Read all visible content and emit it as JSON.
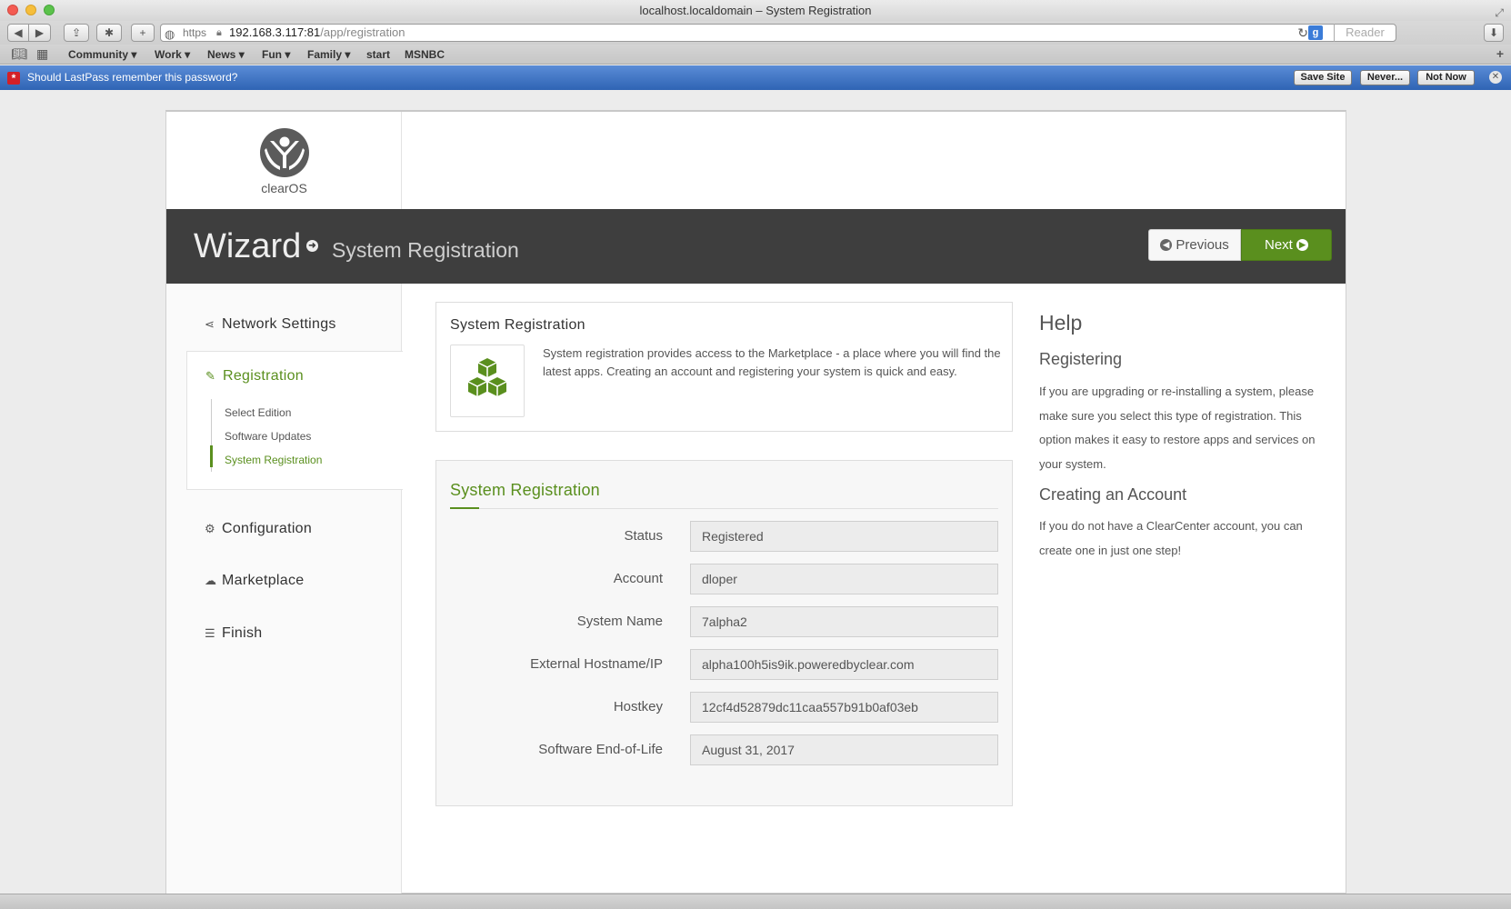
{
  "browser": {
    "title": "localhost.localdomain – System Registration",
    "url_scheme": "https",
    "url_host": "192.168.3.117:81",
    "url_path": "/app/registration",
    "reader_label": "Reader",
    "search_engine_label": "g",
    "bookmarks": [
      "Community",
      "Work",
      "News",
      "Fun",
      "Family",
      "start",
      "MSNBC"
    ]
  },
  "lastpass": {
    "message": "Should LastPass remember this password?",
    "save_site": "Save Site",
    "never": "Never...",
    "not_now": "Not Now"
  },
  "app": {
    "logo_text": "clearOS",
    "wizard_title": "Wizard",
    "wizard_subtitle": "System Registration",
    "previous_label": "Previous",
    "next_label": "Next",
    "accent_color": "#5a8f1e"
  },
  "sidebar": {
    "items": [
      {
        "label": "Network Settings",
        "icon": "share-icon"
      },
      {
        "label": "Registration",
        "icon": "pencil-icon"
      },
      {
        "label": "Configuration",
        "icon": "gears-icon"
      },
      {
        "label": "Marketplace",
        "icon": "cloud-download-icon"
      },
      {
        "label": "Finish",
        "icon": "list-icon"
      }
    ],
    "sub_items": [
      "Select Edition",
      "Software Updates",
      "System Registration"
    ]
  },
  "intro": {
    "title": "System Registration",
    "text": "System registration provides access to the Marketplace - a place where you will find the latest apps. Creating an account and registering your system is quick and easy.",
    "icon": "cubes-icon"
  },
  "form": {
    "title": "System Registration",
    "fields": [
      {
        "label": "Status",
        "value": "Registered"
      },
      {
        "label": "Account",
        "value": "dloper"
      },
      {
        "label": "System Name",
        "value": "7alpha2"
      },
      {
        "label": "External Hostname/IP",
        "value": "alpha100h5is9ik.poweredbyclear.com"
      },
      {
        "label": "Hostkey",
        "value": "12cf4d52879dc11caa557b91b0af03eb"
      },
      {
        "label": "Software End-of-Life",
        "value": "August 31, 2017"
      }
    ]
  },
  "help": {
    "title": "Help",
    "sections": [
      {
        "heading": "Registering",
        "text": "If you are upgrading or re-installing a system, please make sure you select this type of registration. This option makes it easy to restore apps and services on your system."
      },
      {
        "heading": "Creating an Account",
        "text": "If you do not have a ClearCenter account, you can create one in just one step!"
      }
    ]
  }
}
